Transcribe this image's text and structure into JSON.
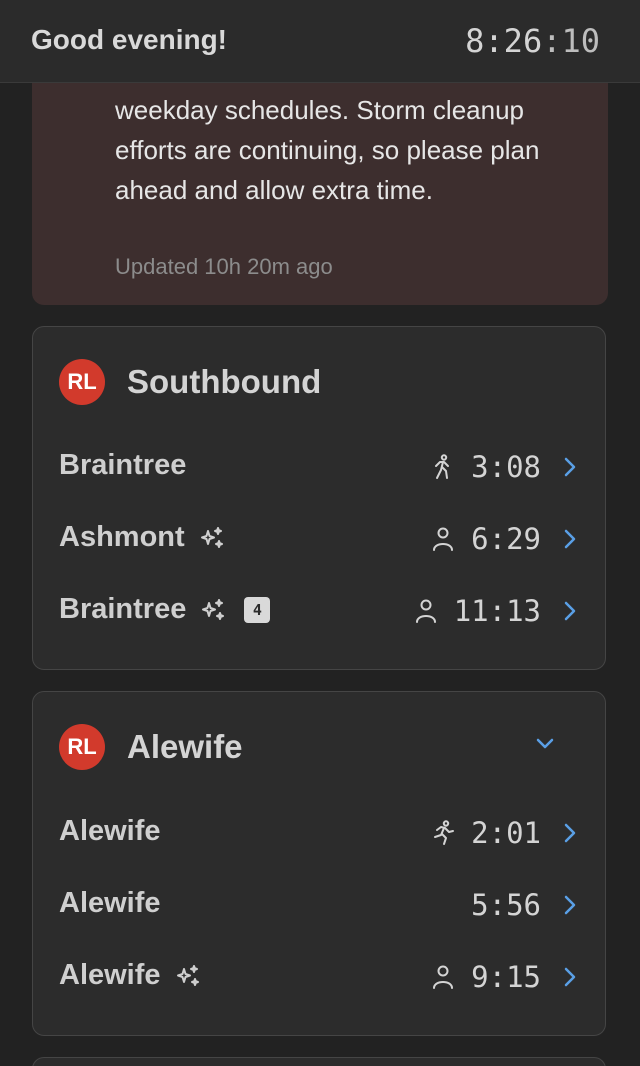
{
  "header": {
    "greeting": "Good evening!",
    "clock_main": "8:26",
    "clock_seconds": ":10"
  },
  "alert": {
    "text": "weekday schedules. Storm cleanup efforts are continuing, so please plan ahead and allow extra time.",
    "updated": "Updated 10h 20m ago"
  },
  "cards": [
    {
      "badge": "RL",
      "title": "Southbound",
      "rows": [
        {
          "destination": "Braintree",
          "status_icon": "walking-icon",
          "time": "3:08"
        },
        {
          "destination": "Ashmont",
          "status_icon": "person-icon",
          "time": "6:29",
          "sparkle": true
        },
        {
          "destination": "Braintree",
          "status_icon": "person-icon",
          "time": "11:13",
          "sparkle": true,
          "cars": "4"
        }
      ]
    },
    {
      "badge": "RL",
      "title": "Alewife",
      "rows": [
        {
          "destination": "Alewife",
          "status_icon": "running-icon",
          "time": "2:01"
        },
        {
          "destination": "Alewife",
          "status_icon": "",
          "time": "5:56"
        },
        {
          "destination": "Alewife",
          "status_icon": "person-icon",
          "time": "9:15",
          "sparkle": true
        }
      ]
    }
  ],
  "colors": {
    "line_red": "#d23a2c",
    "accent_blue": "#5a9fe6",
    "alert_bg": "#3d2e2e"
  }
}
